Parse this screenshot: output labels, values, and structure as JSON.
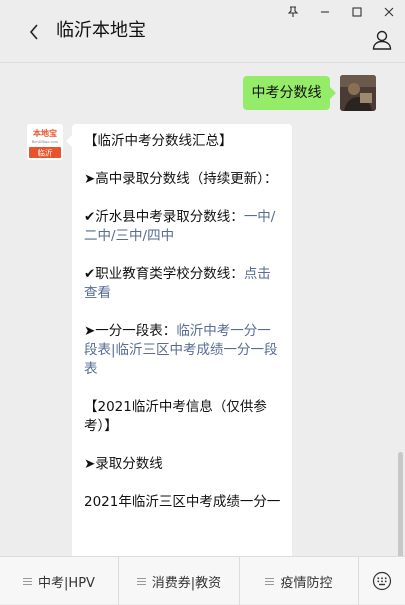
{
  "window": {
    "title": "临沂本地宝"
  },
  "chat": {
    "user_message": "中考分数线",
    "bot_avatar_text_top": "本地宝",
    "bot_avatar_text_sub": "BenDiBao.com",
    "bot_avatar_city": "临沂",
    "bot_message": {
      "header": "【临沂中考分数线汇总】",
      "section1": "➤高中录取分数线（持续更新）：",
      "line1_prefix": "✔沂水县中考录取分数线：",
      "line1_links": "一中/二中/三中/四中",
      "line2_prefix": "✔职业教育类学校分数线：",
      "line2_link": "点击查看",
      "line3_prefix": "➤一分一段表：",
      "line3_link": "临沂中考一分一段表|临沂三区中考成绩一分一段表",
      "info_header": "【2021临沂中考信息（仅供参考）】",
      "section2": "➤录取分数线",
      "line4": "2021年临沂三区中考成绩一分一"
    }
  },
  "menu": {
    "item1": "中考|HPV",
    "item2": "消费券|教资",
    "item3": "疫情防控"
  },
  "colors": {
    "user_bubble": "#95ec69",
    "link": "#576b95",
    "background": "#ededed"
  }
}
